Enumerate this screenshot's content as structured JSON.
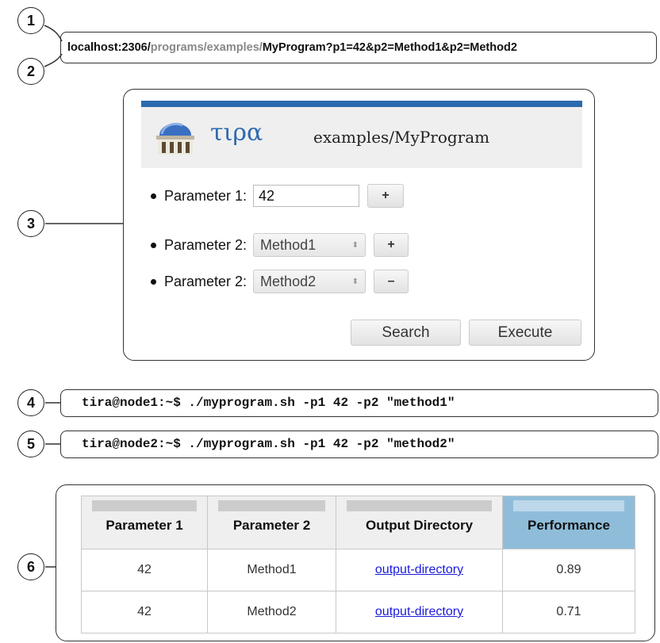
{
  "callouts": [
    "1",
    "2",
    "3",
    "4",
    "5",
    "6"
  ],
  "url": {
    "host": "localhost:2306/",
    "path": "programs/examples/",
    "query": "MyProgram?p1=42&p2=Method1&p2=Method2"
  },
  "app": {
    "logo_text": "τιρα",
    "title": "examples/MyProgram"
  },
  "params": [
    {
      "label": "Parameter 1:",
      "value": "42",
      "button": "+"
    },
    {
      "label": "Parameter 2:",
      "value": "Method1",
      "button": "+"
    },
    {
      "label": "Parameter 2:",
      "value": "Method2",
      "button": "–"
    }
  ],
  "actions": {
    "search": "Search",
    "execute": "Execute"
  },
  "commands": [
    "tira@node1:~$ ./myprogram.sh -p1 42 -p2 \"method1\"",
    "tira@node2:~$ ./myprogram.sh -p1 42 -p2 \"method2\""
  ],
  "results": {
    "headers": [
      "Parameter 1",
      "Parameter 2",
      "Output Directory",
      "Performance"
    ],
    "rows": [
      [
        "42",
        "Method1",
        "output-directory",
        "0.89"
      ],
      [
        "42",
        "Method2",
        "output-directory",
        "0.71"
      ]
    ]
  },
  "colors": {
    "accent": "#2c6aad",
    "performance_header": "#8fbdd9",
    "link": "#1a1adc"
  }
}
